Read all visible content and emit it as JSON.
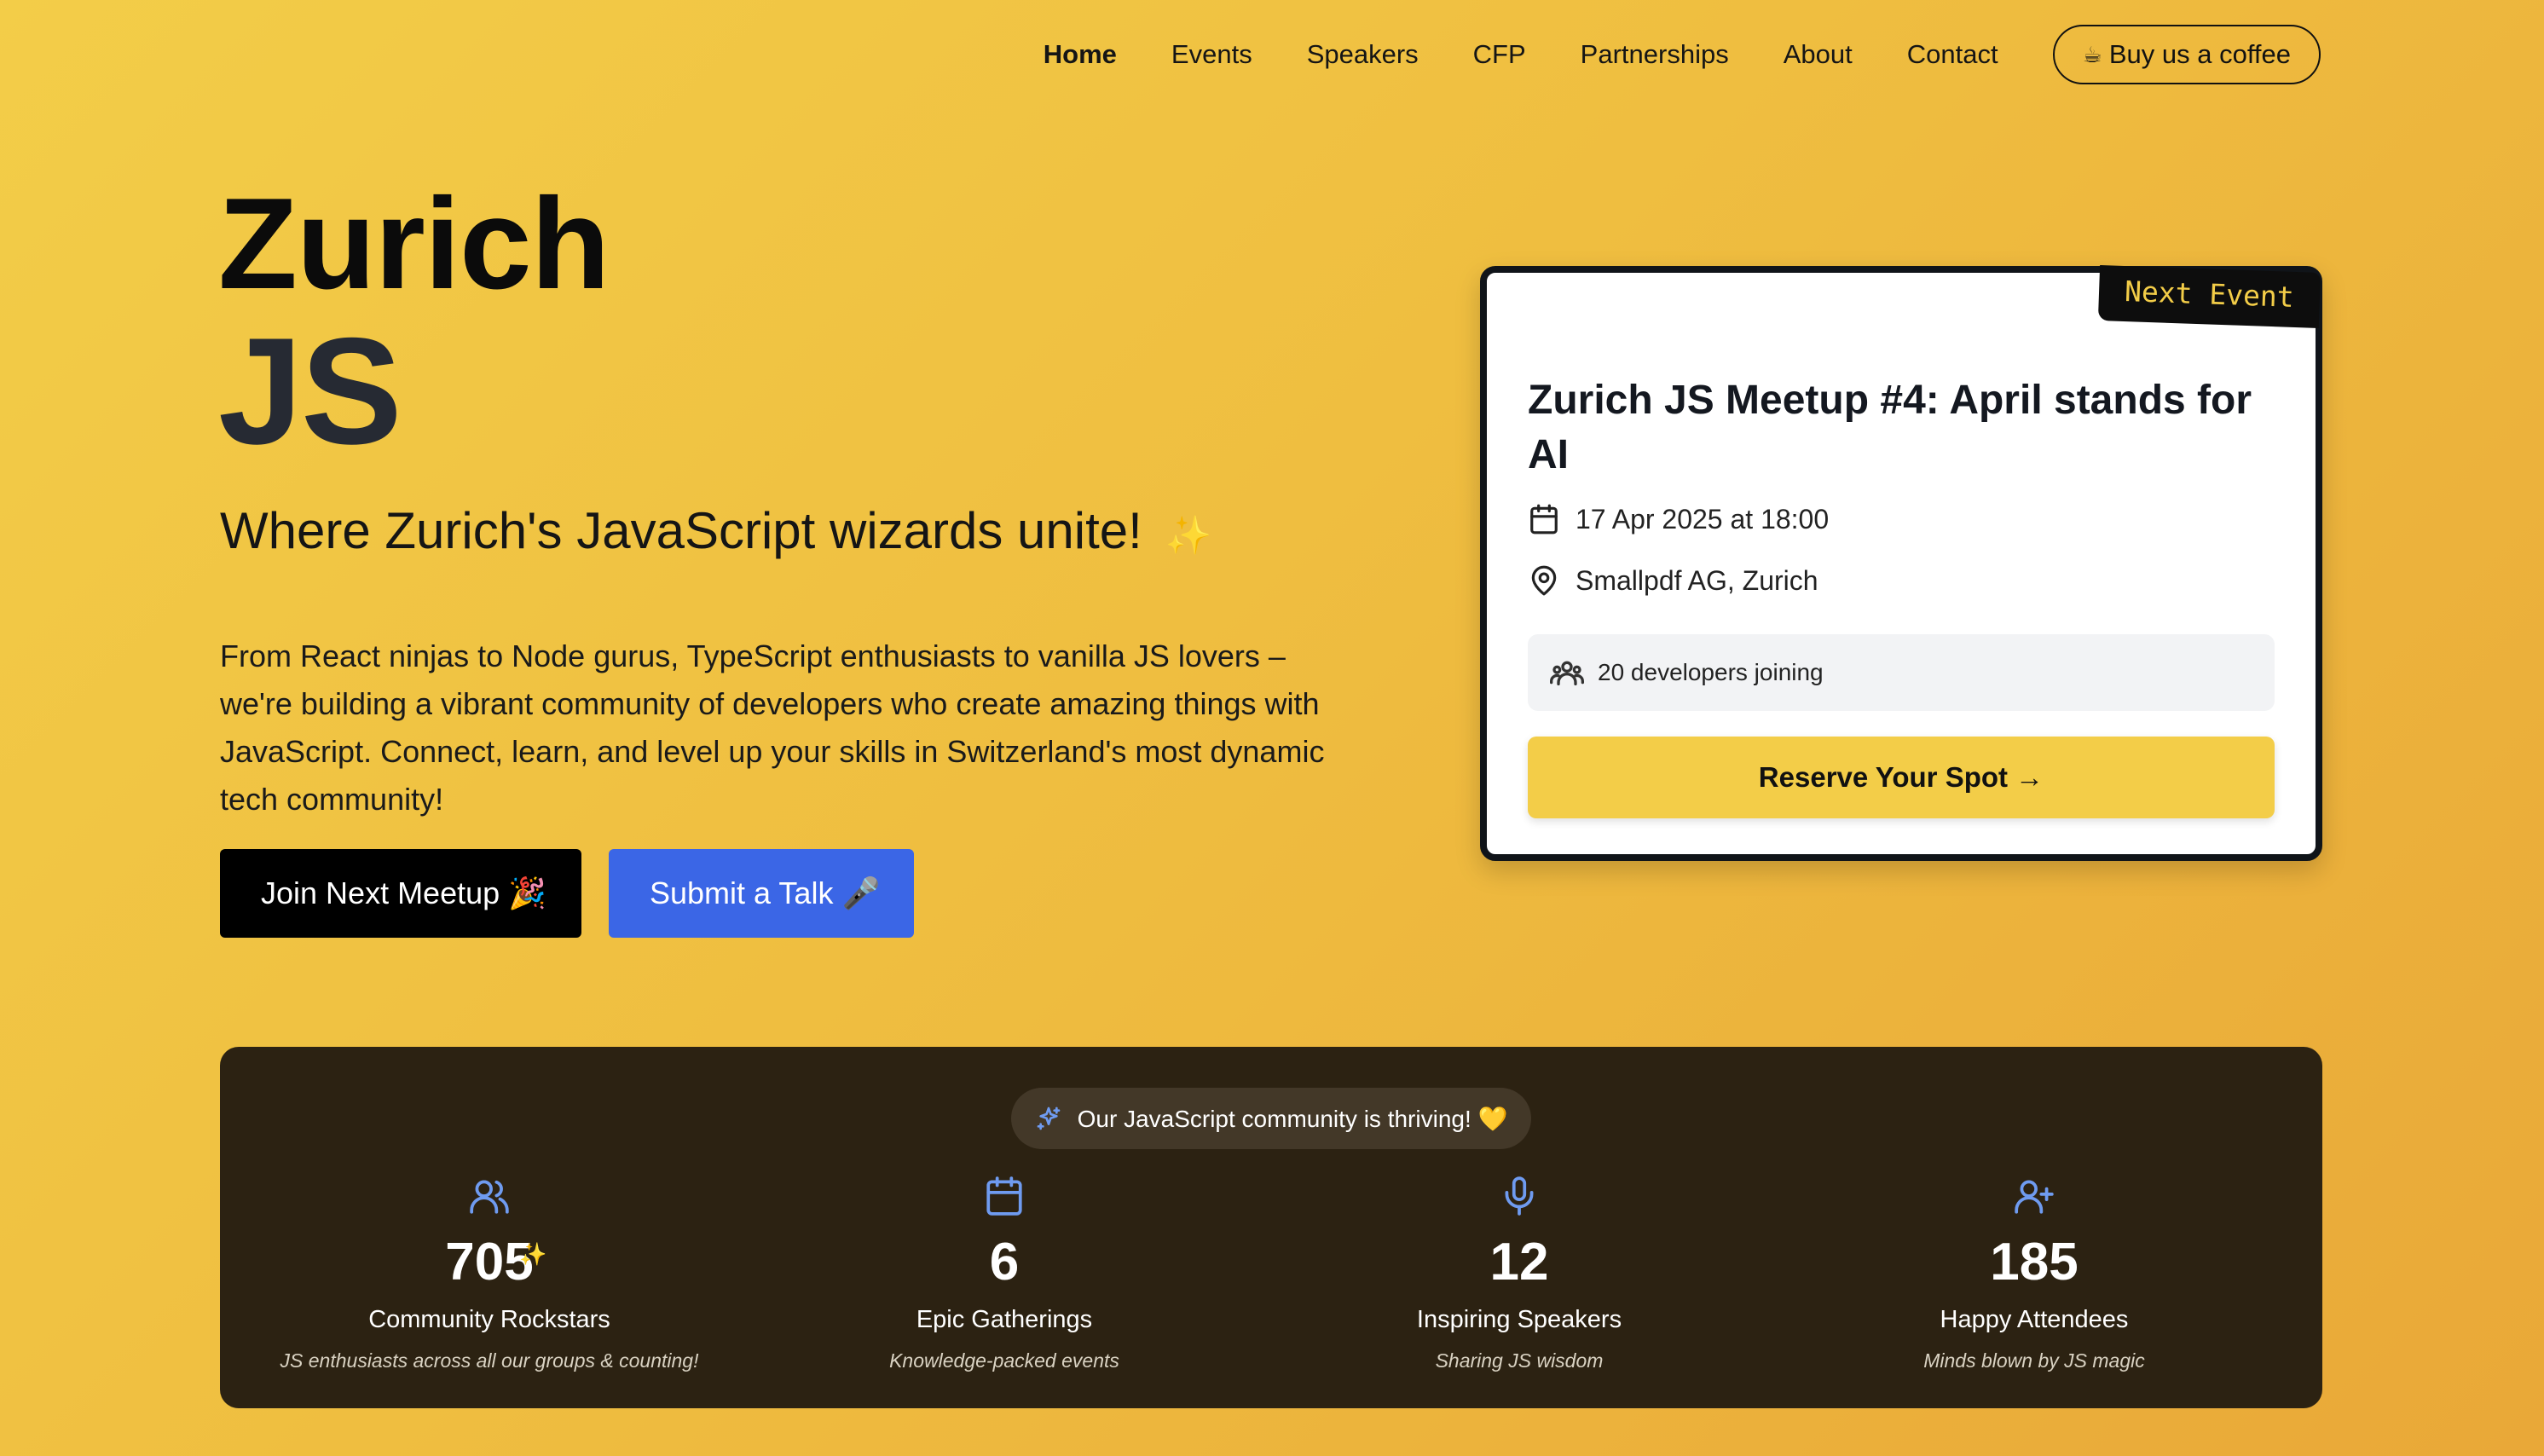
{
  "nav": {
    "items": [
      {
        "label": "Home",
        "active": true
      },
      {
        "label": "Events"
      },
      {
        "label": "Speakers"
      },
      {
        "label": "CFP"
      },
      {
        "label": "Partnerships"
      },
      {
        "label": "About"
      },
      {
        "label": "Contact"
      }
    ],
    "coffee_icon": "☕",
    "coffee_label": "Buy us a coffee"
  },
  "hero": {
    "title_line1": "Zurich",
    "title_line2": "JS",
    "tagline": "Where Zurich's JavaScript wizards unite!",
    "tagline_emoji": "✨",
    "description": "From React ninjas to Node gurus, TypeScript enthusiasts to vanilla JS lovers – we're building a vibrant community of developers who create amazing things with JavaScript. Connect, learn, and level up your skills in Switzerland's most dynamic tech community!",
    "primary_button": "Join Next Meetup 🎉",
    "secondary_button": "Submit a Talk 🎤"
  },
  "event_card": {
    "badge": "Next Event",
    "title": "Zurich JS Meetup #4: April stands for AI",
    "date": "17 Apr 2025 at 18:00",
    "location": "Smallpdf AG, Zurich",
    "joining": "20 developers joining",
    "cta": "Reserve Your Spot →"
  },
  "stats": {
    "banner": "Our JavaScript community is thriving! 💛",
    "items": [
      {
        "icon": "users-icon",
        "value": "705",
        "sparkle": "✨",
        "label": "Community Rockstars",
        "desc": "JS enthusiasts across all our groups & counting!"
      },
      {
        "icon": "calendar-icon",
        "value": "6",
        "label": "Epic Gatherings",
        "desc": "Knowledge-packed events"
      },
      {
        "icon": "microphone-icon",
        "value": "12",
        "label": "Inspiring Speakers",
        "desc": "Sharing JS wisdom"
      },
      {
        "icon": "user-plus-icon",
        "value": "185",
        "label": "Happy Attendees",
        "desc": "Minds blown by JS magic"
      }
    ]
  },
  "colors": {
    "accent_yellow": "#f3cd48",
    "dark": "#2c2212",
    "blue": "#3b66e6",
    "icon_blue": "#6f9bf0"
  }
}
